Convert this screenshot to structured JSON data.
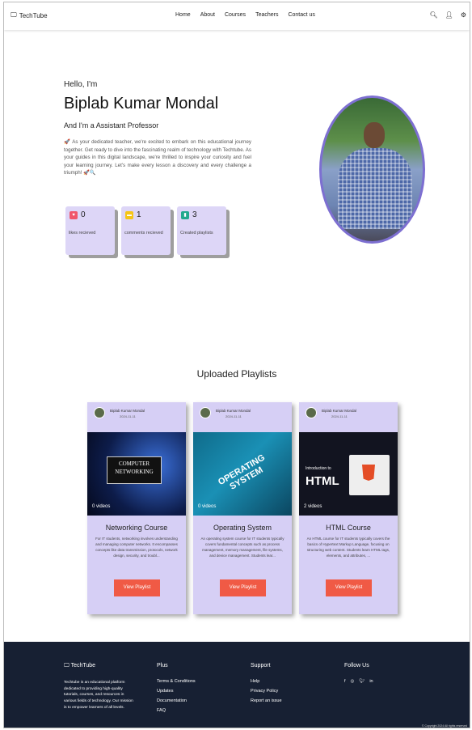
{
  "header": {
    "logo": "TechTube",
    "nav": [
      "Home",
      "About",
      "Courses",
      "Teachers",
      "Contact us"
    ]
  },
  "hero": {
    "greeting": "Hello, I'm",
    "name": "Biplab Kumar Mondal",
    "role": "And I'm a Assistant Professor",
    "intro": "🚀 As your dedicated teacher, we're excited to embark on this educational journey together. Get ready to dive into the fascinating realm of technology with Techtube. As your guides in this digital landscape, we're thrilled to inspire your curiosity and fuel your learning journey. Let's make every lesson a discovery and every challenge a triumph! 🚀🔍"
  },
  "stats": [
    {
      "value": "0",
      "label": "likes recieved",
      "color": "#f0566b"
    },
    {
      "value": "1",
      "label": "comments recieved",
      "color": "#f5c518"
    },
    {
      "value": "3",
      "label": "Created playlists",
      "color": "#22a98e"
    }
  ],
  "playlists": {
    "heading": "Uploaded Playlists",
    "button": "View Playlist",
    "items": [
      {
        "author": "Biplab Kumar Mondal",
        "date": "2024-11-11",
        "videos": "0 videos",
        "thumb_text": "COMPUTER NETWORKING",
        "title": "Networking Course",
        "desc": "For IT students, networking involves understanding and managing computer networks. It encompasses concepts like data transmission, protocols, network design, security, and troubl..."
      },
      {
        "author": "Biplab Kumar Mondal",
        "date": "2024-11-11",
        "videos": "0 videos",
        "thumb_text": "OPERATING SYSTEM",
        "title": "Operating System",
        "desc": "An operating system course for IT students typically covers fundamental concepts such as process management, memory management, file systems, and device management. Students lear..."
      },
      {
        "author": "Biplab Kumar Mondal",
        "date": "2024-11-11",
        "videos": "2 videos",
        "thumb_text": "HTML",
        "thumb_sub": "Introduction to",
        "title": "HTML Course",
        "desc": "An HTML course for IT students typically covers the basics of Hypertext Markup Language, focusing on structuring web content. Students learn HTML tags, elements, and attributes, ..."
      }
    ]
  },
  "footer": {
    "brand": "TechTube",
    "about": "Techtube is an educational platform dedicated to providing high-quality tutorials, courses, and resources in various fields of technology. Our mission is to empower learners of all levels.",
    "plus_title": "Plus",
    "plus": [
      "Terms & Conditions",
      "Updates",
      "Documentation",
      "FAQ"
    ],
    "support_title": "Support",
    "support": [
      "Help",
      "Privacy Policy",
      "Report an issue"
    ],
    "follow_title": "Follow Us",
    "copyright": "© Copyright 2024 All rights reserved"
  }
}
